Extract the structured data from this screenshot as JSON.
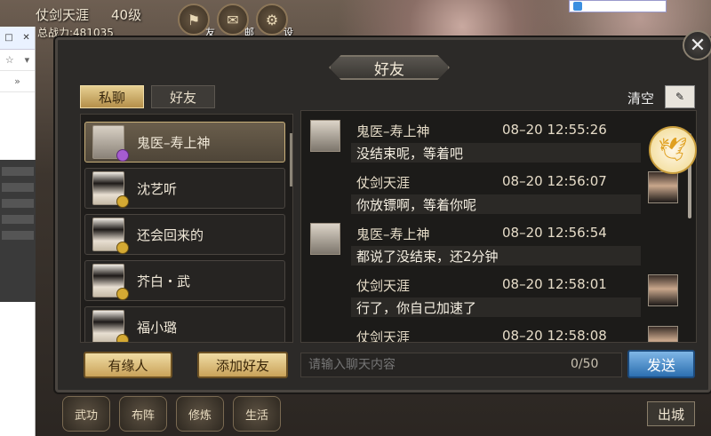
{
  "hud": {
    "player_name": "仗剑天涯",
    "level": "40级",
    "power": "总战力:481035",
    "icons": [
      {
        "name": "friends",
        "label": "友"
      },
      {
        "name": "mail",
        "label": "邮"
      },
      {
        "name": "settings",
        "label": "设"
      }
    ]
  },
  "panel": {
    "title": "好友",
    "close": "✕"
  },
  "tabs": [
    {
      "label": "私聊",
      "active": true
    },
    {
      "label": "好友",
      "active": false
    }
  ],
  "friends": [
    {
      "name": "鬼医–寿上神",
      "selected": true,
      "badge": "purple"
    },
    {
      "name": "沈艺听",
      "selected": false,
      "badge": "gold"
    },
    {
      "name": "还会回来的",
      "selected": false,
      "badge": "gold"
    },
    {
      "name": "芥白・武",
      "selected": false,
      "badge": "gold"
    },
    {
      "name": "福小璐",
      "selected": false,
      "badge": "gold"
    }
  ],
  "left_buttons": {
    "fate": "有缘人",
    "add_friend": "添加好友"
  },
  "chat": {
    "clear_label": "清空",
    "messages": [
      {
        "sender": "鬼医–寿上神",
        "time": "08–20 12:55:26",
        "text": "没结束呢，等着吧",
        "side": "left"
      },
      {
        "sender": "仗剑天涯",
        "time": "08–20 12:56:07",
        "text": "你放镖啊，等着你呢",
        "side": "right"
      },
      {
        "sender": "鬼医–寿上神",
        "time": "08–20 12:56:54",
        "text": "都说了没结束，还2分钟",
        "side": "left"
      },
      {
        "sender": "仗剑天涯",
        "time": "08–20 12:58:01",
        "text": "行了，你自己加速了",
        "side": "right"
      },
      {
        "sender": "仗剑天涯",
        "time": "08–20 12:58:08",
        "text": "",
        "side": "right"
      }
    ]
  },
  "input": {
    "placeholder": "请输入聊天内容",
    "counter": "0/50",
    "send": "发送"
  },
  "bottom": {
    "icons": [
      "武功",
      "布阵",
      "修炼",
      "生活"
    ],
    "exit": "出城"
  }
}
